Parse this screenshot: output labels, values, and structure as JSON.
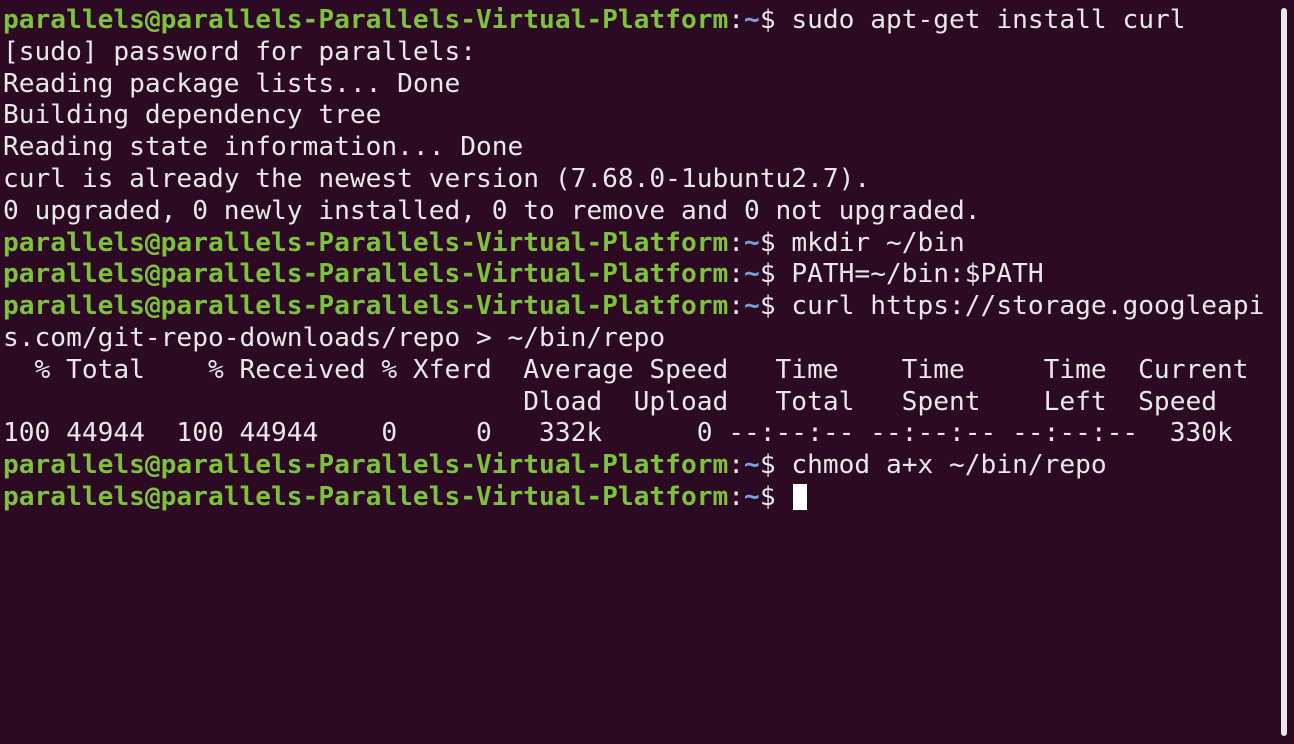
{
  "prompt": {
    "user_host": "parallels@parallels-Parallels-Virtual-Platform",
    "separator": ":",
    "path": "~",
    "symbol": "$ "
  },
  "lines": [
    {
      "type": "prompt",
      "command": "sudo apt-get install curl"
    },
    {
      "type": "output",
      "text": "[sudo] password for parallels:"
    },
    {
      "type": "output",
      "text": "Reading package lists... Done"
    },
    {
      "type": "output",
      "text": "Building dependency tree"
    },
    {
      "type": "output",
      "text": "Reading state information... Done"
    },
    {
      "type": "output",
      "text": "curl is already the newest version (7.68.0-1ubuntu2.7)."
    },
    {
      "type": "output",
      "text": "0 upgraded, 0 newly installed, 0 to remove and 0 not upgraded."
    },
    {
      "type": "prompt",
      "command": "mkdir ~/bin"
    },
    {
      "type": "prompt",
      "command": "PATH=~/bin:$PATH"
    },
    {
      "type": "prompt",
      "command": "curl https://storage.googleapi"
    },
    {
      "type": "output",
      "text": "s.com/git-repo-downloads/repo > ~/bin/repo"
    },
    {
      "type": "output",
      "text": "  % Total    % Received % Xferd  Average Speed   Time    Time     Time  Current"
    },
    {
      "type": "output",
      "text": "                                 Dload  Upload   Total   Spent    Left  Speed"
    },
    {
      "type": "output",
      "text": "100 44944  100 44944    0     0   332k      0 --:--:-- --:--:-- --:--:--  330k"
    },
    {
      "type": "prompt",
      "command": "chmod a+x ~/bin/repo"
    },
    {
      "type": "prompt_cursor",
      "command": ""
    }
  ]
}
